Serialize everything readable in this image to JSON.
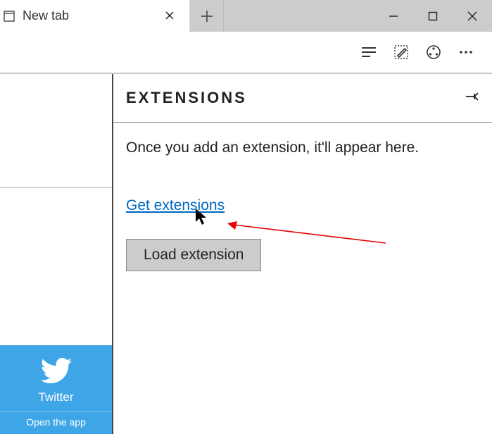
{
  "tab": {
    "title": "New tab"
  },
  "panel": {
    "title": "EXTENSIONS",
    "intro": "Once you add an extension, it'll appear here.",
    "get_link": "Get extensions",
    "load_button": "Load extension"
  },
  "sidebar": {
    "twitter_label": "Twitter",
    "twitter_open": "Open the app"
  }
}
